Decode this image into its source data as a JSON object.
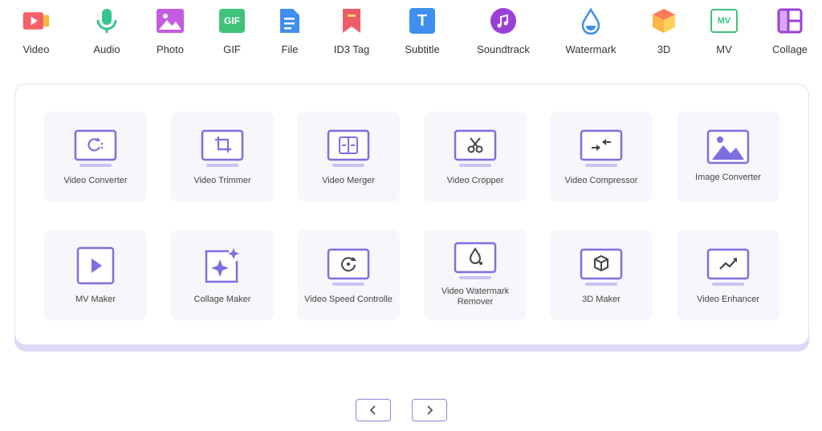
{
  "nav": {
    "items": [
      {
        "label": "Video",
        "icon": "video-icon"
      },
      {
        "label": "Audio",
        "icon": "microphone-icon"
      },
      {
        "label": "Photo",
        "icon": "photo-icon"
      },
      {
        "label": "GIF",
        "icon": "gif-icon"
      },
      {
        "label": "File",
        "icon": "file-icon"
      },
      {
        "label": "ID3 Tag",
        "icon": "bookmark-icon"
      },
      {
        "label": "Subtitle",
        "icon": "subtitle-icon"
      },
      {
        "label": "Soundtrack",
        "icon": "music-icon"
      },
      {
        "label": "Watermark",
        "icon": "droplet-icon"
      },
      {
        "label": "3D",
        "icon": "cube-icon"
      },
      {
        "label": "MV",
        "icon": "mv-icon"
      },
      {
        "label": "Collage",
        "icon": "collage-icon"
      }
    ],
    "gif_text": "GIF",
    "mv_text": "MV",
    "subtitle_text": "T"
  },
  "tools": [
    {
      "label": "Video Converter",
      "icon": "convert-icon"
    },
    {
      "label": "Video Trimmer",
      "icon": "crop-icon"
    },
    {
      "label": "Video Merger",
      "icon": "merge-icon"
    },
    {
      "label": "Video Cropper",
      "icon": "scissors-icon"
    },
    {
      "label": "Video Compressor",
      "icon": "compress-icon"
    },
    {
      "label": "Image Converter",
      "icon": "image-icon"
    },
    {
      "label": "MV Maker",
      "icon": "play-icon"
    },
    {
      "label": "Collage Maker",
      "icon": "sparkle-icon"
    },
    {
      "label": "Video Speed Controlle",
      "icon": "speed-icon"
    },
    {
      "label": "Video Watermark Remover",
      "icon": "watermark-remove-icon"
    },
    {
      "label": "3D Maker",
      "icon": "cube-outline-icon"
    },
    {
      "label": "Video Enhancer",
      "icon": "trend-icon"
    }
  ],
  "pager": {
    "prev_icon": "chevron-left-icon",
    "next_icon": "chevron-right-icon"
  },
  "colors": {
    "accent": "#7c6fe0",
    "accent_light": "#c9c3f3",
    "panel_border": "#e2e0f0"
  }
}
